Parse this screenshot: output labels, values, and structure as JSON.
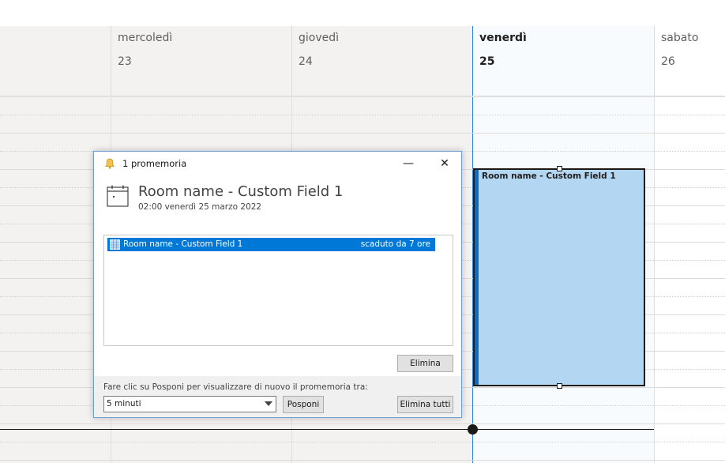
{
  "calendar": {
    "days": [
      {
        "name": "mercoledì",
        "number": "23"
      },
      {
        "name": "giovedì",
        "number": "24"
      },
      {
        "name": "venerdì",
        "number": "25"
      },
      {
        "name": "sabato",
        "number": "26"
      }
    ],
    "event": {
      "title": "Room name - Custom Field 1"
    },
    "accent_color": "#0f6cbd",
    "event_color": "#b3d6f2"
  },
  "reminder": {
    "window_title": "1 promemoria",
    "minimize_glyph": "—",
    "close_glyph": "✕",
    "subject": "Room name - Custom Field 1",
    "when": "02:00 venerdì 25 marzo 2022",
    "list": [
      {
        "subject": "Room name - Custom Field 1",
        "due": "scaduto da 7 ore"
      }
    ],
    "dismiss_label": "Elimina",
    "snooze_prompt": "Fare clic su Posponi per visualizzare di nuovo il promemoria tra:",
    "snooze_value": "5 minuti",
    "snooze_label": "Posponi",
    "dismiss_all_label": "Elimina tutti",
    "icons": [
      "bell-icon",
      "calendar-icon",
      "appointment-icon"
    ]
  }
}
